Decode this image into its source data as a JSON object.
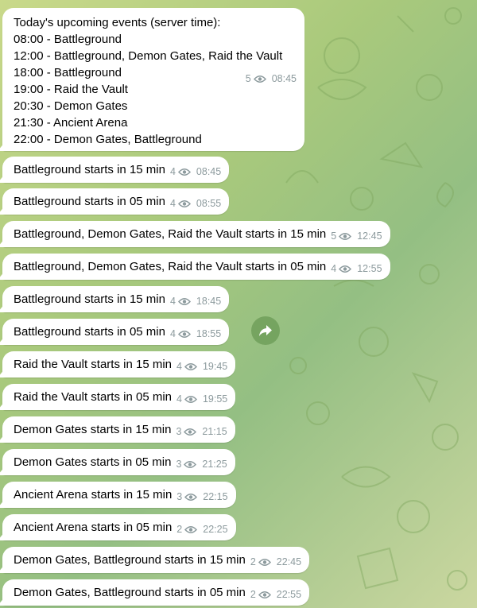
{
  "digest": {
    "title": "Today's upcoming events (server time):",
    "lines": [
      "08:00 - Battleground",
      "12:00 - Battleground, Demon Gates, Raid the Vault",
      "18:00 - Battleground",
      "19:00 - Raid the Vault",
      "20:30 - Demon Gates",
      "21:30 - Ancient Arena",
      "22:00 - Demon Gates, Battleground"
    ],
    "views": "5",
    "time": "08:45"
  },
  "starts_in_text": "starts in",
  "reminders": [
    {
      "event": "Battleground",
      "minutes": "15 min",
      "views": "4",
      "time": "08:45"
    },
    {
      "event": "Battleground",
      "minutes": "05 min",
      "views": "4",
      "time": "08:55"
    },
    {
      "event": "Battleground, Demon Gates, Raid the Vault",
      "minutes": "15 min",
      "views": "5",
      "time": "12:45"
    },
    {
      "event": "Battleground, Demon Gates, Raid the Vault",
      "minutes": "05 min",
      "views": "4",
      "time": "12:55"
    },
    {
      "event": "Battleground",
      "minutes": "15 min",
      "views": "4",
      "time": "18:45"
    },
    {
      "event": "Battleground",
      "minutes": "05 min",
      "views": "4",
      "time": "18:55"
    },
    {
      "event": "Raid the Vault",
      "minutes": "15 min",
      "views": "4",
      "time": "19:45"
    },
    {
      "event": "Raid the Vault",
      "minutes": "05 min",
      "views": "4",
      "time": "19:55"
    },
    {
      "event": "Demon Gates",
      "minutes": "15 min",
      "views": "3",
      "time": "21:15"
    },
    {
      "event": "Demon Gates",
      "minutes": "05 min",
      "views": "3",
      "time": "21:25"
    },
    {
      "event": "Ancient Arena",
      "minutes": "15 min",
      "views": "3",
      "time": "22:15"
    },
    {
      "event": "Ancient Arena",
      "minutes": "05 min",
      "views": "2",
      "time": "22:25"
    },
    {
      "event": "Demon Gates, Battleground",
      "minutes": "15 min",
      "views": "2",
      "time": "22:45"
    },
    {
      "event": "Demon Gates, Battleground",
      "minutes": "05 min",
      "views": "2",
      "time": "22:55"
    }
  ],
  "icons": {
    "views": "eye-icon",
    "forward": "share-arrow-icon"
  },
  "colors": {
    "bubble": "#ffffff",
    "meta": "#8c9a9d",
    "background": "#a9c97c"
  }
}
